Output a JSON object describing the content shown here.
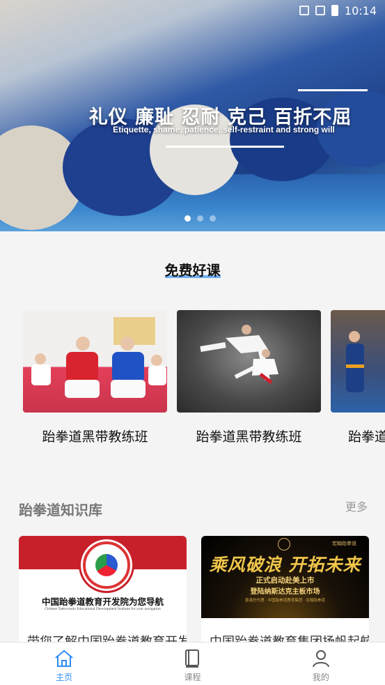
{
  "status_bar": {
    "time": "10:14"
  },
  "banner": {
    "title": "礼仪 廉耻 忍耐 克己 百折不屈",
    "subtitle": "Etiquette, shame, patience, self-restraint and strong will",
    "slide_count": 3,
    "active_slide": 1
  },
  "free_courses": {
    "title": "免费好课",
    "items": [
      {
        "name": "跆拳道黑带教练班"
      },
      {
        "name": "跆拳道黑带教练班"
      },
      {
        "name": "跆拳道黑带教练班"
      }
    ]
  },
  "knowledge": {
    "title": "跆拳道知识库",
    "more_label": "更多",
    "items": [
      {
        "title": "带您了解中国跆拳道教育开发院",
        "image_text": "中国跆拳道教育开发院为您导航",
        "image_subtext": "Chinese Taekwondo Educational Development Institute for your navigation"
      },
      {
        "title": "中国跆拳道教育集团扬帆起航",
        "image_text": "乘风破浪 开拓未来",
        "image_line1": "正式启动赴美上市",
        "image_line2": "登陆纳斯达克主板市场",
        "image_line3": "香港总代理 · 中国跆拳道教育集团 · 宏翰跆拳道",
        "image_brand": "宏翰跆拳道"
      }
    ]
  },
  "tabbar": {
    "active": "home",
    "items": [
      {
        "key": "home",
        "label": "主页",
        "icon": "home-icon"
      },
      {
        "key": "courses",
        "label": "课程",
        "icon": "book-icon"
      },
      {
        "key": "me",
        "label": "我的",
        "icon": "user-icon"
      }
    ]
  },
  "colors": {
    "accent": "#2f8df3",
    "highlight": "#6fb1f2"
  }
}
